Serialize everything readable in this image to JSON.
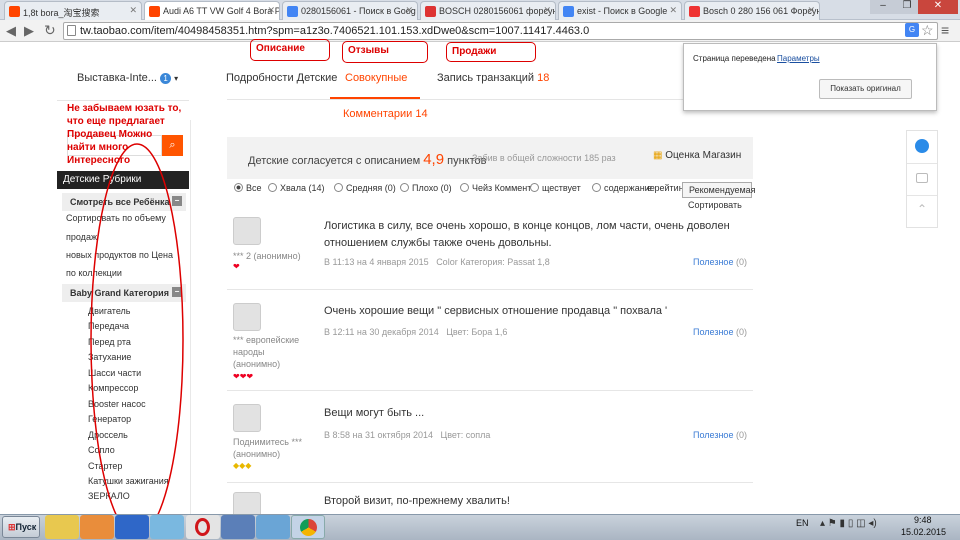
{
  "browser": {
    "tabs": [
      {
        "label": "1,8t bora_淘宝搜索",
        "fav_color": "#f40"
      },
      {
        "label": "Audi A6 TT VW Golf 4 Bora P",
        "fav_color": "#f40"
      },
      {
        "label": "0280156061 - Поиск в Goog",
        "fav_color": "#4285f4"
      },
      {
        "label": "BOSCH 0280156061 форсун",
        "fav_color": "#d33"
      },
      {
        "label": "exist - Поиск в Google",
        "fav_color": "#4285f4"
      },
      {
        "label": "Bosch 0 280 156 061 Форсун",
        "fav_color": "#e33"
      }
    ],
    "url": "tw.taobao.com/item/40498458351.htm?spm=a1z3o.7406521.101.153.xdDwe0&scm=1007.11417.4463.0"
  },
  "translate_popup": {
    "message": "Страница переведена",
    "options_link": "Параметры",
    "show_original": "Показать оригинал"
  },
  "shop": {
    "name": "Выставка-Inte...",
    "badge": "1"
  },
  "sidebar": {
    "header": "Детские Рубрики",
    "section1": "Смотреть все Ребёнка",
    "links": [
      "Сортировать по объему",
      "продаж",
      "новых продуктов по Цена",
      "по коллекции"
    ],
    "section2": "Baby Grand Категория",
    "subcategories": [
      "Двигатель",
      "Передача",
      "Перед рта",
      "Затухание",
      "Шасси части",
      "Компрессор",
      "Booster насос",
      "Генератор",
      "Дроссель",
      "Сопло",
      "Стартер",
      "Катушки зажигания",
      "ЗЕРКАЛО"
    ]
  },
  "main_tabs": {
    "details": "Подробности Детские",
    "cumulative": "Совокупные",
    "transactions": "Запись транзакций",
    "transactions_count": "18",
    "comments": "Комментарии",
    "comments_count": "14"
  },
  "score": {
    "prefix": "Детские согласуется с описанием",
    "value": "4,9",
    "suffix": "пунктов",
    "total": "Забив в общей сложности 185 раз",
    "shop_rating": "Оценка Магазин"
  },
  "filters": {
    "all": "Все",
    "praise": "Хвала",
    "praise_count": "(14)",
    "medium": "Средняя",
    "medium_count": "(0)",
    "bad": "Плохо",
    "bad_count": "(0)",
    "whose": "Чейз Коммент",
    "exists": "ществует",
    "content": "содержание",
    "rating": "е рейтинг",
    "sort_select": "Рекомендуемая",
    "sort_label": "Сортировать"
  },
  "reviews": [
    {
      "user": "*** 2 (анонимно)",
      "hearts": "❤",
      "text": "Логистика в силу, все очень хорошо, в конце концов, лом части, очень доволен отношением службы также очень довольны.",
      "date": "В 11:13 на 4 января 2015",
      "meta": "Color Категория: Passat 1,8",
      "useful": "Полезное",
      "useful_count": "(0)"
    },
    {
      "user": "*** европейские народы (анонимно)",
      "hearts": "❤❤❤",
      "text": "Очень хорошие вещи \" сервисных отношение продавца \" похвала '",
      "date": "В 12:11 на 30 декабря 2014",
      "meta": "Цвет: Бора 1,6",
      "useful": "Полезное",
      "useful_count": "(0)"
    },
    {
      "user": "Поднимитесь *** (анонимно)",
      "hearts": "◆◆◆",
      "text": "Вещи могут быть ...",
      "date": "В 8:58 на 31 октября 2014",
      "meta": "Цвет: сопла",
      "useful": "Полезное",
      "useful_count": "(0)"
    },
    {
      "user": "",
      "hearts": "",
      "text": "Второй визит, по-прежнему хвалить!",
      "date": "",
      "meta": "",
      "useful": "",
      "useful_count": ""
    }
  ],
  "annotations": {
    "description": "Описание",
    "reviews": "Отзывы",
    "sales": "Продажи",
    "note": "Не забываем юзать то, что еще предлагает Продавец Можно найти много Интересного"
  },
  "taskbar": {
    "start": "Пуск",
    "lang": "EN",
    "time": "9:48",
    "date": "15.02.2015"
  }
}
